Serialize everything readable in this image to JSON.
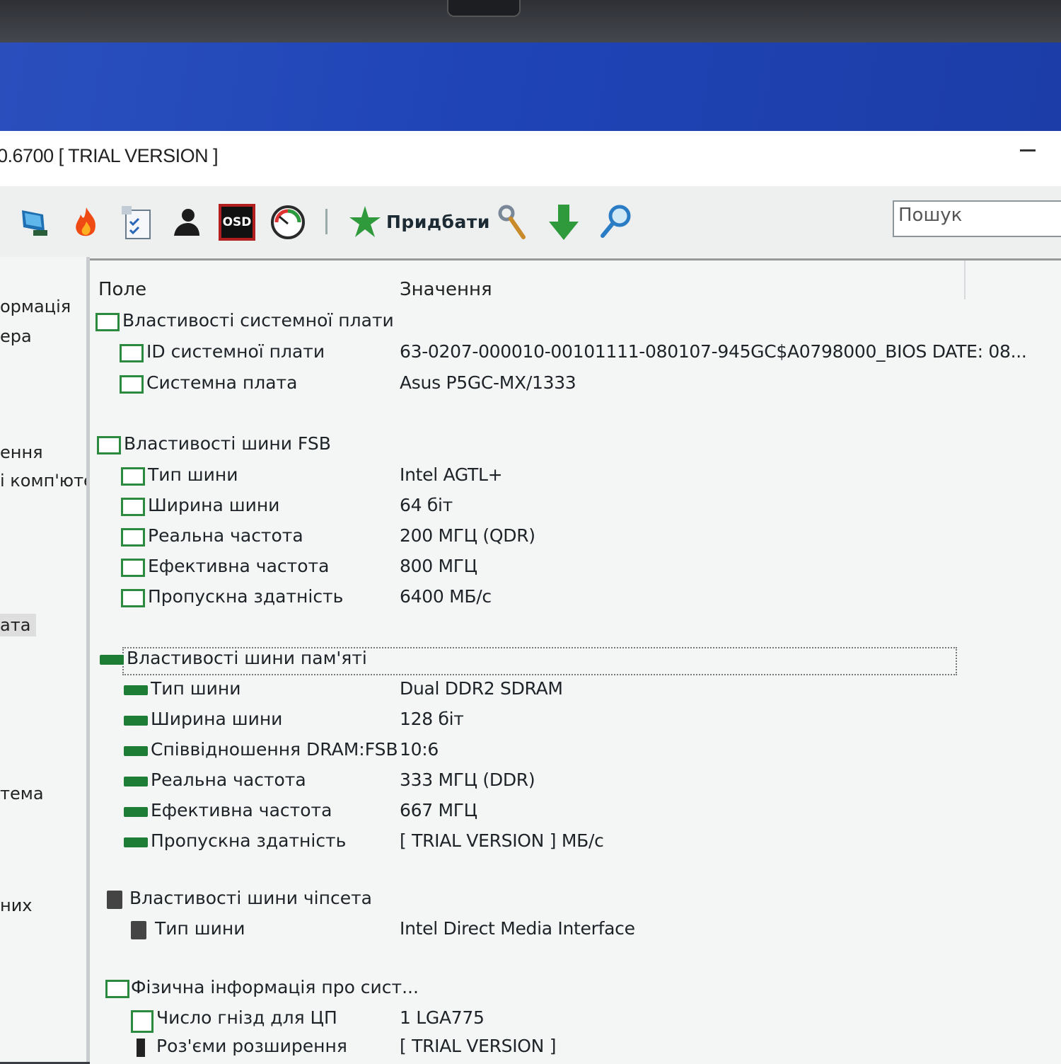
{
  "window": {
    "title": "0.6700  [ TRIAL VERSION ]"
  },
  "toolbar": {
    "icons": [
      "computer-icon",
      "benchmark-flame-icon",
      "report-icon",
      "user-icon",
      "osd-icon",
      "gauge-icon"
    ],
    "osd_label": "OSD",
    "buy_label": "Придбати",
    "tools": [
      "wrench-icon",
      "download-arrow-icon",
      "search-magnifier-icon"
    ],
    "search_placeholder": "Пошук"
  },
  "left_panel": {
    "items": [
      "ормація",
      "ера",
      "ення",
      "і комп'юте",
      "ата",
      "тема",
      "них"
    ],
    "selected_label": "ата"
  },
  "table": {
    "col_field": "Поле",
    "col_value": "Значення",
    "groups": [
      {
        "title": "Властивості системної плати",
        "icon": "motherboard-icon",
        "rows": [
          {
            "field": "ID системної плати",
            "value": "63-0207-000010-00101111-080107-945GC$A0798000_BIOS DATE: 08..."
          },
          {
            "field": "Системна плата",
            "value": "Asus P5GC-MX/1333"
          }
        ]
      },
      {
        "title": "Властивості шини FSB",
        "icon": "motherboard-icon",
        "rows": [
          {
            "field": "Тип шини",
            "value": "Intel AGTL+"
          },
          {
            "field": "Ширина шини",
            "value": "64 біт"
          },
          {
            "field": "Реальна частота",
            "value": "200 МГЦ (QDR)"
          },
          {
            "field": "Ефективна частота",
            "value": "800 МГЦ"
          },
          {
            "field": "Пропускна здатність",
            "value": "6400 МБ/с"
          }
        ]
      },
      {
        "title": "Властивості шини пам'яті",
        "icon": "memory-icon",
        "rows": [
          {
            "field": "Тип шини",
            "value": "Dual DDR2 SDRAM"
          },
          {
            "field": "Ширина шини",
            "value": "128 біт"
          },
          {
            "field": "Співвідношення DRAM:FSB",
            "value": "10:6"
          },
          {
            "field": "Реальна частота",
            "value": "333 МГЦ (DDR)"
          },
          {
            "field": "Ефективна частота",
            "value": "667 МГЦ"
          },
          {
            "field": "Пропускна здатність",
            "value": "[ TRIAL VERSION ] МБ/с"
          }
        ]
      },
      {
        "title": "Властивості шини чіпсета",
        "icon": "chipset-icon",
        "rows": [
          {
            "field": "Тип шини",
            "value": "Intel Direct Media Interface"
          }
        ]
      },
      {
        "title": "Фізична інформація про сист...",
        "icon": "motherboard-icon",
        "rows": [
          {
            "field": "Число гнізд для ЦП",
            "value": "1 LGA775"
          },
          {
            "field": "Роз'єми розширення",
            "value": "[ TRIAL VERSION ]"
          }
        ]
      }
    ]
  }
}
